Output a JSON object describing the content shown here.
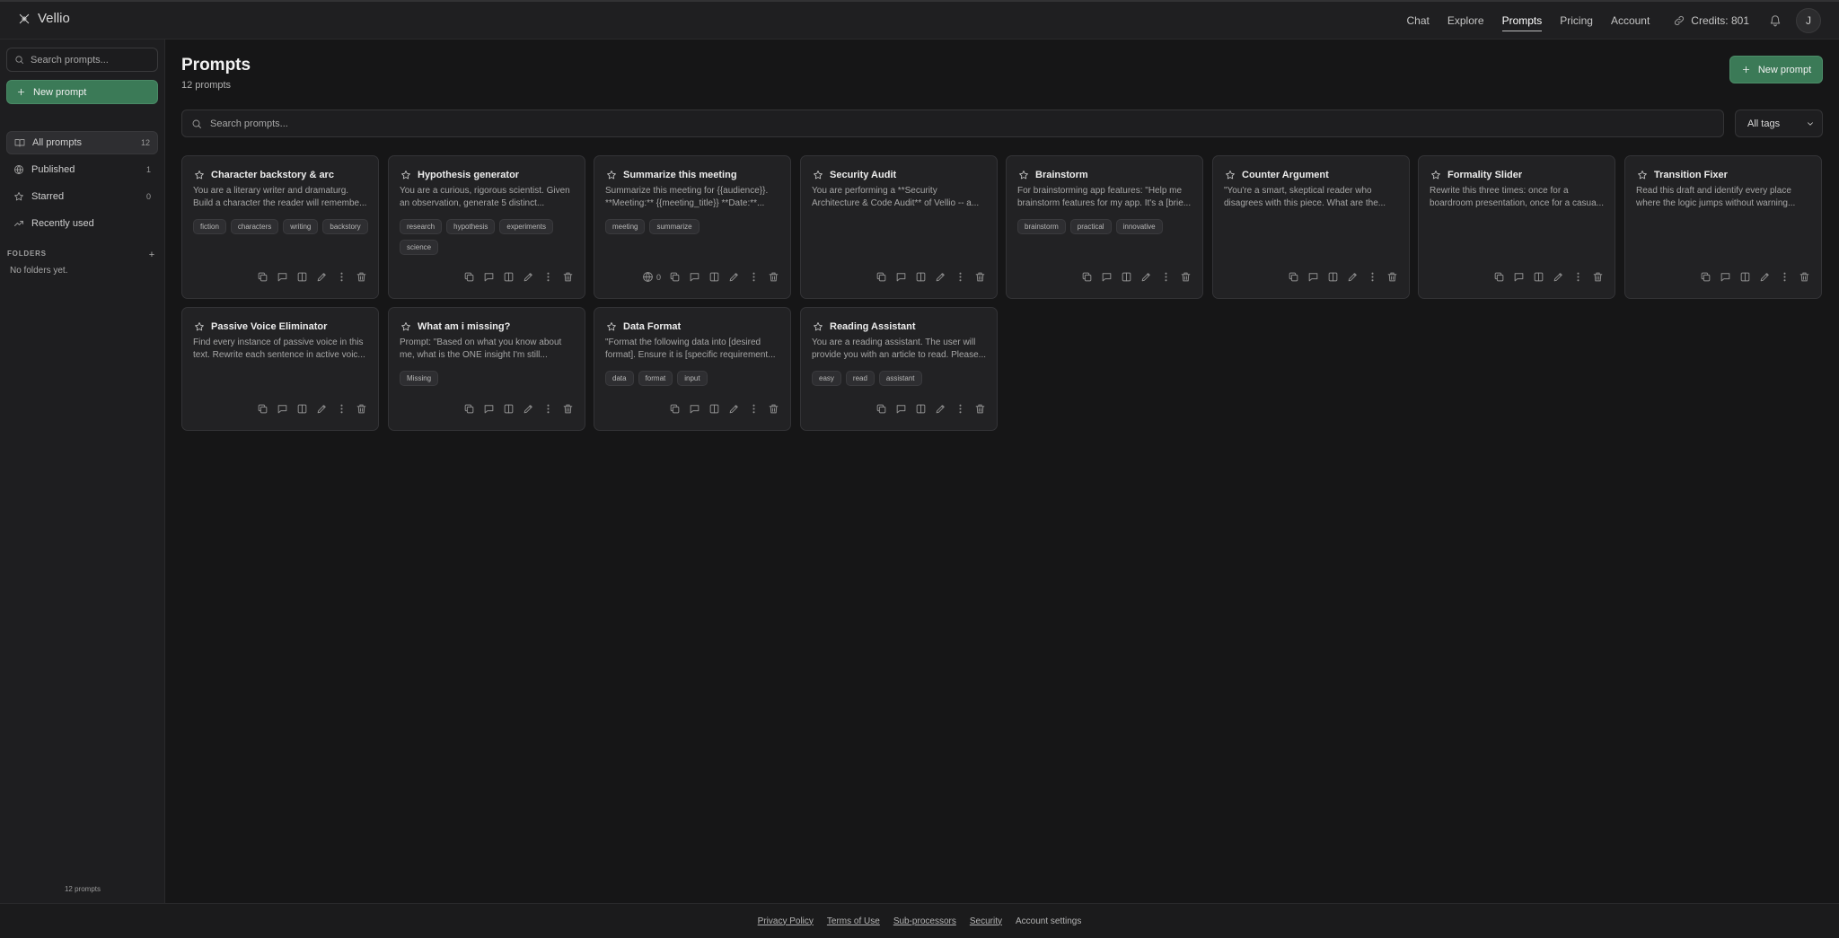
{
  "app": {
    "name": "Vellio"
  },
  "nav": {
    "links": [
      "Chat",
      "Explore",
      "Prompts",
      "Pricing",
      "Account"
    ],
    "active": "Prompts",
    "credits": "Credits: 801",
    "avatar_initial": "J"
  },
  "sidebar": {
    "search_placeholder": "Search prompts...",
    "new_prompt": "New prompt",
    "items": [
      {
        "label": "All prompts",
        "count": "12",
        "icon": "book-icon"
      },
      {
        "label": "Published",
        "count": "1",
        "icon": "globe-icon"
      },
      {
        "label": "Starred",
        "count": "0",
        "icon": "star-icon"
      },
      {
        "label": "Recently used",
        "count": "",
        "icon": "trending-icon"
      }
    ],
    "folders_heading": "FOLDERS",
    "folders_add": "+",
    "no_folders": "No folders yet.",
    "footer_count": "12 prompts"
  },
  "main": {
    "title": "Prompts",
    "subtitle": "12 prompts",
    "new_prompt": "New prompt",
    "search_placeholder": "Search prompts...",
    "tags_filter": "All tags"
  },
  "cards": [
    {
      "title": "Character backstory & arc",
      "desc": [
        "You are a literary writer and dramaturg.",
        "Build a character the reader will remembe..."
      ],
      "tags": [
        "fiction",
        "characters",
        "writing",
        "backstory"
      ],
      "published": ""
    },
    {
      "title": "Hypothesis generator",
      "desc": [
        "You are a curious, rigorous scientist. Given",
        "an observation, generate 5 distinct..."
      ],
      "tags": [
        "research",
        "hypothesis",
        "experiments",
        "science"
      ],
      "published": ""
    },
    {
      "title": "Summarize this meeting",
      "desc": [
        "Summarize this meeting for {{audience}}.",
        "**Meeting:** {{meeting_title}} **Date:**..."
      ],
      "tags": [
        "meeting",
        "summarize"
      ],
      "published": "0"
    },
    {
      "title": "Security Audit",
      "desc": [
        "You are performing a **Security",
        "Architecture & Code Audit** of Vellio -- a..."
      ],
      "tags": [],
      "published": ""
    },
    {
      "title": "Brainstorm",
      "desc": [
        "For brainstorming app features: \"Help me",
        "brainstorm features for my app. It's a [brie..."
      ],
      "tags": [
        "brainstorm",
        "practical",
        "innovative"
      ],
      "published": ""
    },
    {
      "title": "Counter Argument",
      "desc": [
        "\"You're a smart, skeptical reader who",
        "disagrees with this piece. What are the..."
      ],
      "tags": [],
      "published": ""
    },
    {
      "title": "Formality Slider",
      "desc": [
        "Rewrite this three times: once for a",
        "boardroom presentation, once for a casua..."
      ],
      "tags": [],
      "published": ""
    },
    {
      "title": "Transition Fixer",
      "desc": [
        "Read this draft and identify every place",
        "where the logic jumps without warning..."
      ],
      "tags": [],
      "published": ""
    },
    {
      "title": "Passive Voice Eliminator",
      "desc": [
        "Find every instance of passive voice in this",
        "text. Rewrite each sentence in active voic..."
      ],
      "tags": [],
      "published": ""
    },
    {
      "title": "What am i missing?",
      "desc": [
        "Prompt: \"Based on what you know about",
        "me, what is the ONE insight I'm still..."
      ],
      "tags": [
        "Missing"
      ],
      "published": ""
    },
    {
      "title": "Data Format",
      "desc": [
        "\"Format the following data into [desired",
        "format]. Ensure it is [specific requirement..."
      ],
      "tags": [
        "data",
        "format",
        "input"
      ],
      "published": ""
    },
    {
      "title": "Reading Assistant",
      "desc": [
        "You are a reading assistant. The user will",
        "provide you with an article to read. Please..."
      ],
      "tags": [
        "easy",
        "read",
        "assistant"
      ],
      "published": ""
    }
  ],
  "footer": {
    "links": [
      "Privacy Policy",
      "Terms of Use",
      "Sub-processors",
      "Security"
    ],
    "account_settings": "Account settings"
  }
}
